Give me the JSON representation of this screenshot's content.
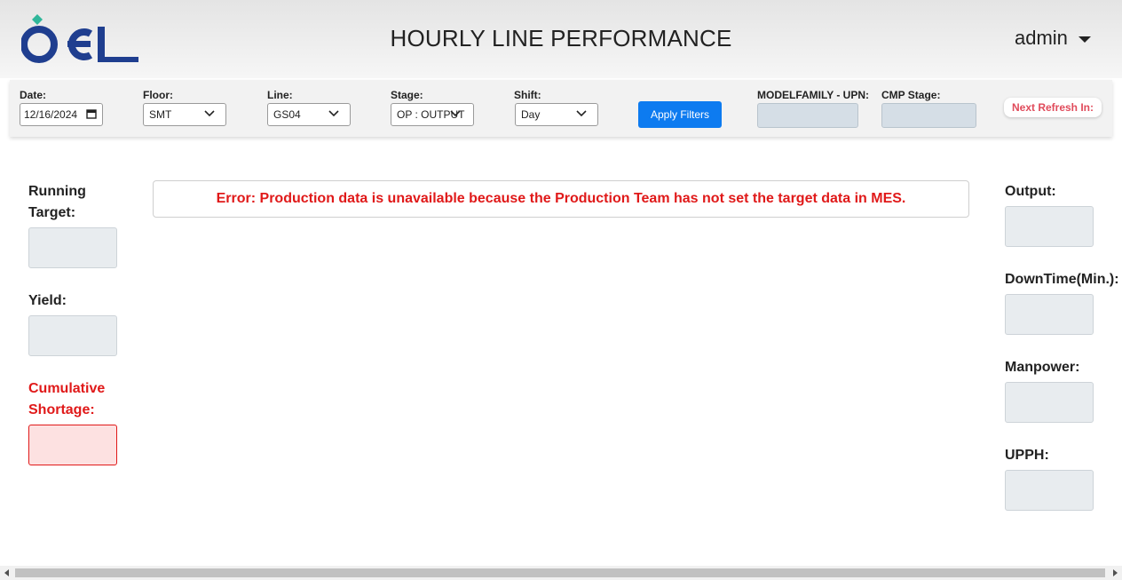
{
  "header": {
    "title": "HOURLY LINE PERFORMANCE",
    "user": "admin",
    "logo_text": "OEL"
  },
  "filters": {
    "date_label": "Date:",
    "date_value": "12/16/2024",
    "floor_label": "Floor:",
    "floor_value": "SMT",
    "line_label": "Line:",
    "line_value": "GS04",
    "stage_label": "Stage:",
    "stage_value": "OP : OUTPUT",
    "shift_label": "Shift:",
    "shift_value": "Day",
    "apply_label": "Apply Filters",
    "modelfamily_label": "MODELFAMILY - UPN:",
    "cmp_stage_label": "CMP Stage:",
    "refresh_label": "Next Refresh In:"
  },
  "left_metrics": {
    "running_target": "Running Target:",
    "yield": "Yield:",
    "cumulative_shortage": "Cumulative Shortage:"
  },
  "right_metrics": {
    "output": "Output:",
    "downtime": "DownTime(Min.):",
    "manpower": "Manpower:",
    "upph": "UPPH:"
  },
  "error_message": "Error: Production data is unavailable because the Production Team has not set the target data in MES.",
  "colors": {
    "accent_blue": "#0d7bf0",
    "error_red": "#e01919",
    "logo_blue": "#1f3e8f",
    "logo_green": "#2fb69a"
  }
}
